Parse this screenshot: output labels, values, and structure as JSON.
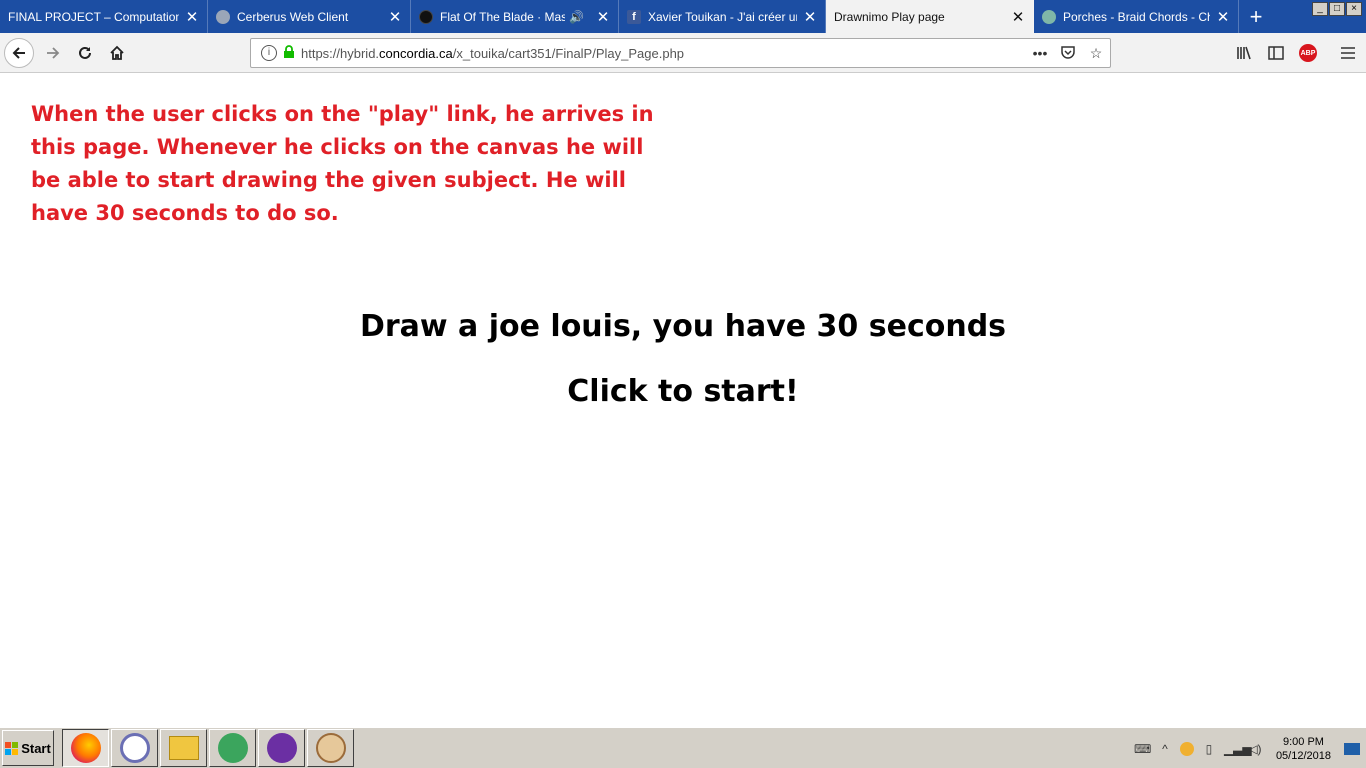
{
  "browser": {
    "tabs": [
      {
        "title": "FINAL PROJECT – Computation Lab",
        "favicon": "none",
        "active": false
      },
      {
        "title": "Cerberus Web Client",
        "favicon": "cerberus-icon",
        "active": false
      },
      {
        "title": "Flat Of The Blade · Massive",
        "favicon": "spotify-icon",
        "active": false,
        "audio": true
      },
      {
        "title": "Xavier Touikan - J'ai créer un s",
        "favicon": "facebook-icon",
        "active": false
      },
      {
        "title": "Drawnimo Play page",
        "favicon": "none",
        "active": true
      },
      {
        "title": "Porches - Braid Chords - Chord",
        "favicon": "chords-icon",
        "active": false
      }
    ],
    "new_tab_label": "+",
    "url_prefix": "https://hybrid.",
    "url_domain": "concordia.ca",
    "url_path": "/x_touika/cart351/FinalP/Play_Page.php",
    "window_controls": [
      "_",
      "□",
      "×"
    ],
    "abp_label": "ABP"
  },
  "page": {
    "note": "When the user clicks on the \"play\" link, he arrives in this page. Whenever he clicks on the canvas he will be able to start drawing the given subject. He will have 30 seconds to do so.",
    "prompt_line1": "Draw a joe louis, you have 30 seconds",
    "prompt_line2": "Click to start!",
    "note_color": "#e02027"
  },
  "taskbar": {
    "start_label": "Start",
    "apps": [
      "firefox-icon",
      "bittorrent-icon",
      "file-explorer-icon",
      "atom-icon",
      "gitkraken-icon",
      "paint-icon"
    ],
    "time": "9:00 PM",
    "date": "05/12/2018"
  }
}
